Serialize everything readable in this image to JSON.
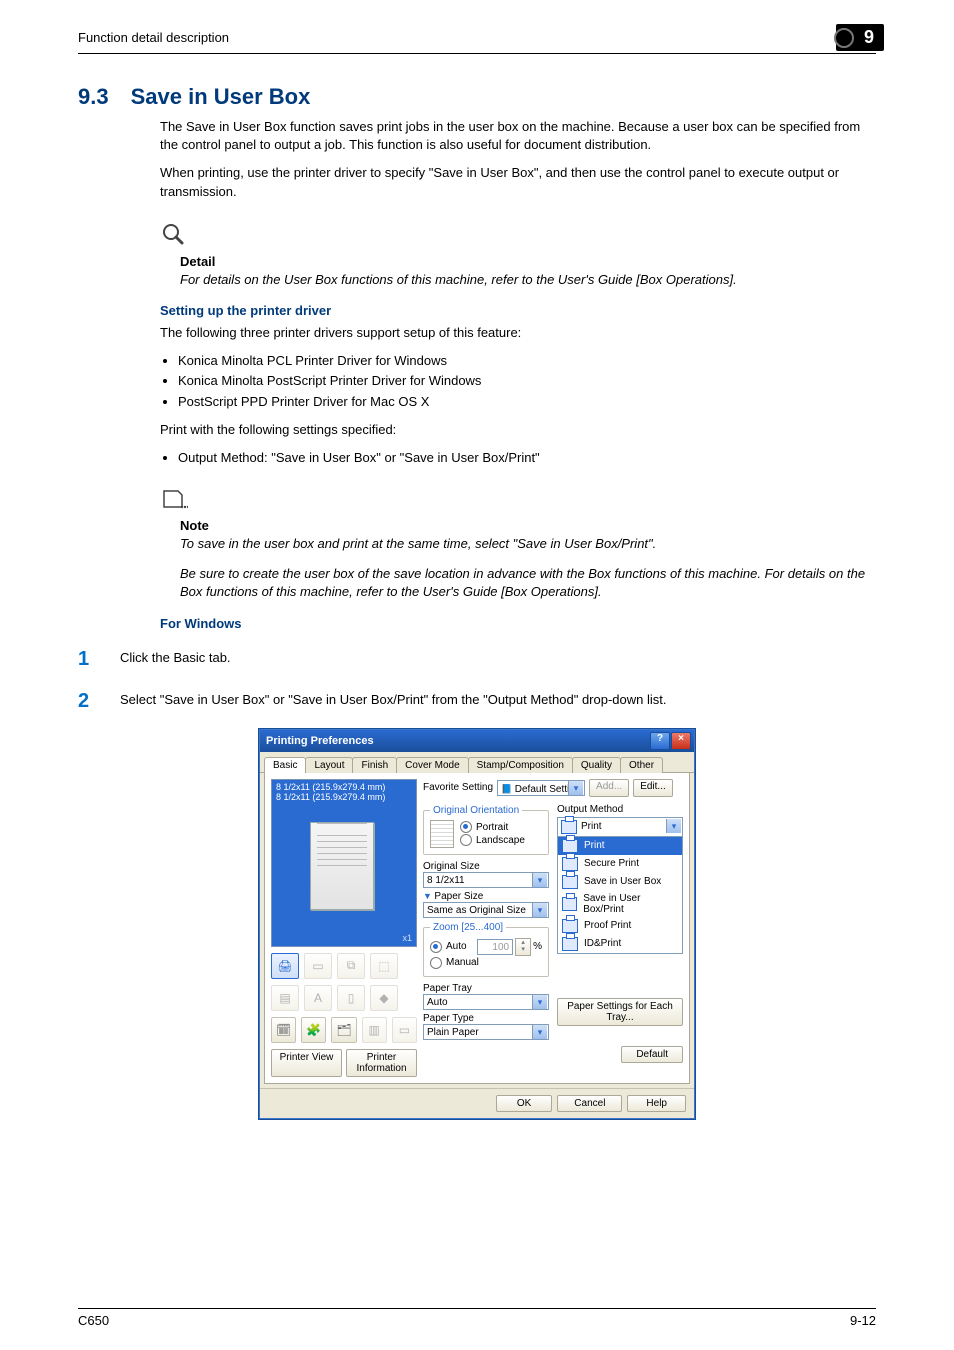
{
  "running_head": "Function detail description",
  "chapter_number": "9",
  "section": {
    "number": "9.3",
    "title": "Save in User Box"
  },
  "intro_para1": "The Save in User Box function saves print jobs in the user box on the machine. Because a user box can be specified from the control panel to output a job. This function is also useful for document distribution.",
  "intro_para2": "When printing, use the printer driver to specify \"Save in User Box\", and then use the control panel to execute output or transmission.",
  "detail": {
    "label": "Detail",
    "text": "For details on the User Box functions of this machine, refer to the User's Guide [Box Operations]."
  },
  "sub_setup_driver": "Setting up the printer driver",
  "drivers_intro": "The following three printer drivers support setup of this feature:",
  "drivers": [
    "Konica Minolta PCL Printer Driver for Windows",
    "Konica Minolta PostScript Printer Driver for Windows",
    "PostScript PPD Printer Driver for Mac OS X"
  ],
  "print_with": "Print with the following settings specified:",
  "output_method_bullet": "Output Method: \"Save in User Box\" or \"Save in User Box/Print\"",
  "note": {
    "label": "Note",
    "line1": "To save in the user box and print at the same time, select \"Save in User Box/Print\".",
    "line2": "Be sure to create the user box of the save location in advance with the Box functions of this machine. For details on the Box functions of this machine, refer to the User's Guide [Box Operations]."
  },
  "for_windows": "For Windows",
  "steps": [
    "Click the Basic tab.",
    "Select \"Save in User Box\" or \"Save in User Box/Print\" from the \"Output Method\" drop-down list."
  ],
  "dialog": {
    "title": "Printing Preferences",
    "tabs": [
      "Basic",
      "Layout",
      "Finish",
      "Cover Mode",
      "Stamp/Composition",
      "Quality",
      "Other"
    ],
    "active_tab_index": 0,
    "favorite_label": "Favorite Setting",
    "favorite_value": "Default Setting",
    "add_btn": "Add...",
    "edit_btn": "Edit...",
    "preview_size1": "8 1/2x11 (215.9x279.4 mm)",
    "preview_size2": "8 1/2x11 (215.9x279.4 mm)",
    "x1": "x1",
    "orientation": {
      "legend": "Original Orientation",
      "portrait": "Portrait",
      "landscape": "Landscape"
    },
    "original_size_label": "Original Size",
    "original_size_value": "8 1/2x11",
    "paper_size_label": "Paper Size",
    "paper_size_value": "Same as Original Size",
    "zoom": {
      "legend": "Zoom [25...400]",
      "auto": "Auto",
      "manual": "Manual",
      "value": "100",
      "percent": "%"
    },
    "paper_tray_label": "Paper Tray",
    "paper_tray_value": "Auto",
    "paper_type_label": "Paper Type",
    "paper_type_value": "Plain Paper",
    "output_method_label": "Output Method",
    "output_method_value": "Print",
    "output_method_items": [
      "Print",
      "Secure Print",
      "Save in User Box",
      "Save in User Box/Print",
      "Proof Print",
      "ID&Print"
    ],
    "paper_settings_btn": "Paper Settings for Each Tray...",
    "default_btn": "Default",
    "printer_view": "Printer View",
    "printer_info": "Printer Information",
    "ok": "OK",
    "cancel": "Cancel",
    "help": "Help"
  },
  "footer": {
    "left": "C650",
    "right": "9-12"
  }
}
